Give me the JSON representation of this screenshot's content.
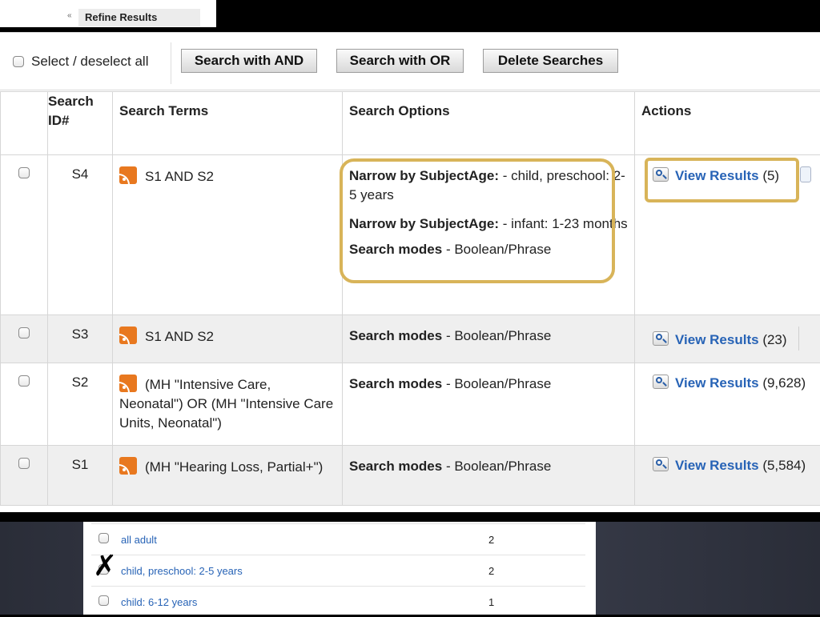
{
  "refine_panel": {
    "tab_label": "Refine Results",
    "collapse_icon": "«"
  },
  "toolbar": {
    "select_all_label": "Select / deselect all",
    "search_and_label": "Search with AND",
    "search_or_label": "Search with OR",
    "delete_label": "Delete Searches"
  },
  "table": {
    "headers": {
      "search_id": "Search ID#",
      "terms": "Search Terms",
      "options": "Search Options",
      "actions": "Actions"
    },
    "view_results_label": "View Results",
    "rows": [
      {
        "id": "S4",
        "terms": "S1 AND S2",
        "options": [
          {
            "bold": "Narrow by SubjectAge:",
            "text": " - child, preschool: 2-5 years"
          },
          {
            "bold": "Narrow by SubjectAge:",
            "text": " - infant: 1-23 months"
          },
          {
            "bold": "Search modes",
            "text": " - Boolean/Phrase"
          }
        ],
        "count": "(5)"
      },
      {
        "id": "S3",
        "terms": "S1 AND S2",
        "options": [
          {
            "bold": "Search modes",
            "text": " - Boolean/Phrase"
          }
        ],
        "count": "(23)"
      },
      {
        "id": "S2",
        "terms": "(MH \"Intensive Care, Neonatal\") OR (MH \"Intensive Care Units, Neonatal\")",
        "options": [
          {
            "bold": "Search modes",
            "text": " - Boolean/Phrase"
          }
        ],
        "count": "(9,628)"
      },
      {
        "id": "S1",
        "terms": "(MH \"Hearing Loss, Partial+\")",
        "options": [
          {
            "bold": "Search modes",
            "text": " - Boolean/Phrase"
          }
        ],
        "count": "(5,584)"
      }
    ]
  },
  "facets": [
    {
      "label": "all adult",
      "count": "2"
    },
    {
      "label": "child, preschool: 2-5 years",
      "count": "2"
    },
    {
      "label": "child: 6-12 years",
      "count": "1"
    }
  ],
  "annotation": {
    "x_mark": "✗"
  },
  "colors": {
    "link": "#2763b6",
    "highlight": "#d8b459",
    "rss": "#e8781f"
  }
}
